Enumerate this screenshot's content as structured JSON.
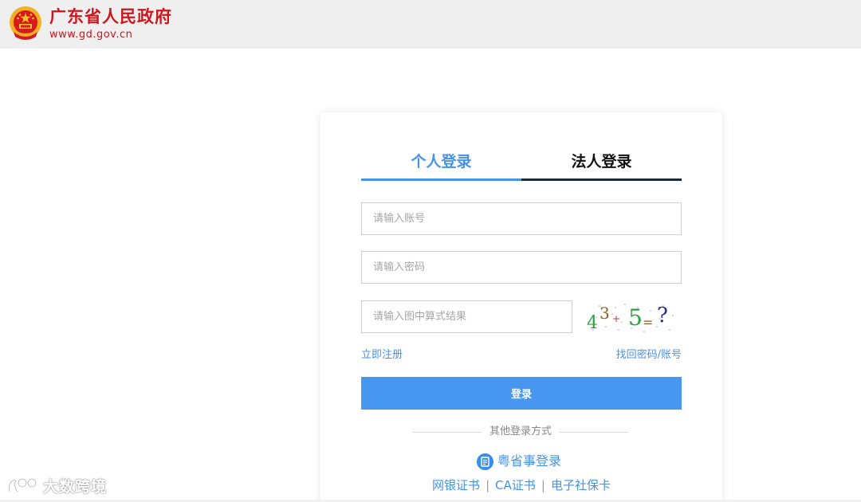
{
  "header": {
    "site_title": "广东省人民政府",
    "site_url": "www.gd.gov.cn",
    "emblem_icon": "national-emblem-icon"
  },
  "login": {
    "tabs": [
      {
        "label": "个人登录",
        "active": true
      },
      {
        "label": "法人登录",
        "active": false
      }
    ],
    "account_placeholder": "请输入账号",
    "password_placeholder": "请输入密码",
    "captcha_placeholder": "请输入图中算式结果",
    "captcha_image_text": "4 3 + 5 = ?",
    "register_link": "立即注册",
    "recover_link": "找回密码/账号",
    "submit_label": "登录",
    "other_methods_title": "其他登录方式",
    "yss_login_label": "粤省事登录",
    "yss_icon": "yueshengshi-icon",
    "alt_methods": [
      "网银证书",
      "CA证书",
      "电子社保卡"
    ],
    "alt_separator": "|"
  },
  "watermark": {
    "text": "大数跨境"
  },
  "colors": {
    "brand_red": "#d0161c",
    "accent_blue": "#4593e8",
    "button_blue": "#4796f0",
    "header_bg": "#efefef"
  }
}
